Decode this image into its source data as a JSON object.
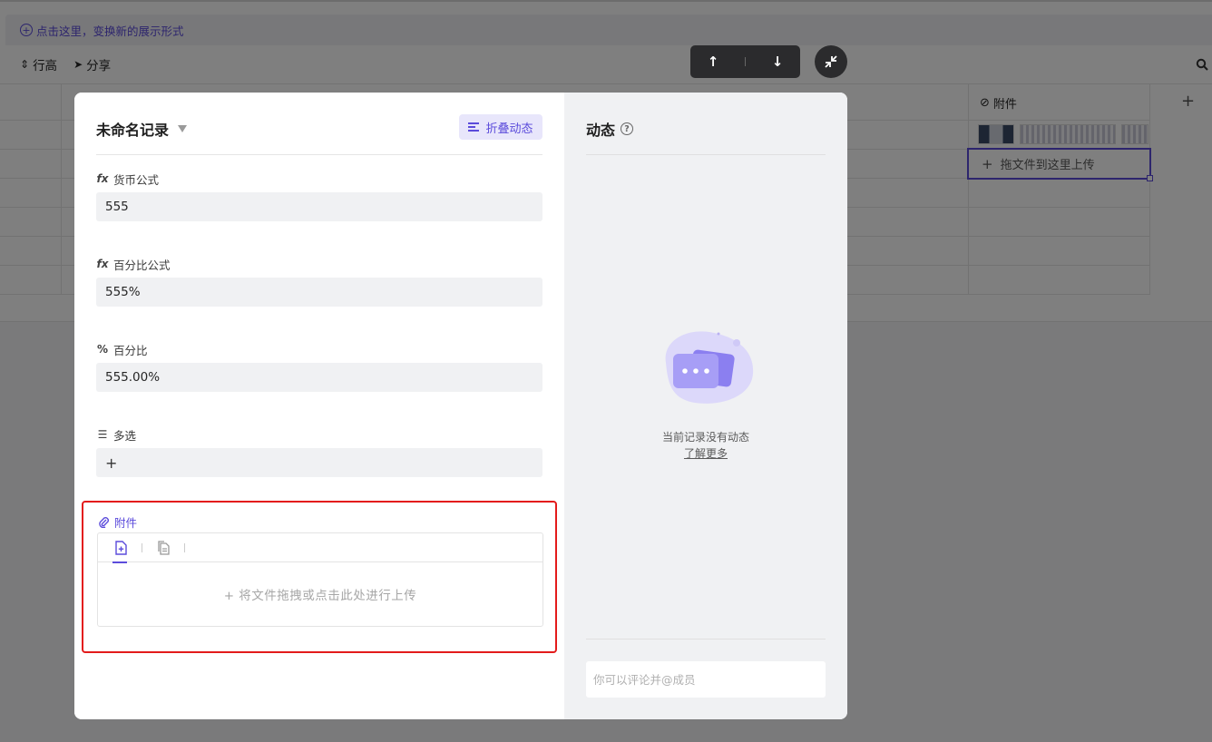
{
  "background": {
    "hint_text": "点击这里，变换新的展示形式",
    "toolbar": {
      "row_height_label": "行高",
      "share_label": "分享"
    },
    "grid": {
      "attachment_column_label": "附件",
      "upload_cell_text": "拖文件到这里上传"
    }
  },
  "nav": {
    "up_arrow": "↑",
    "down_arrow": "↓"
  },
  "record": {
    "title": "未命名记录",
    "fold_button_label": "折叠动态",
    "fields": [
      {
        "label": "货币公式",
        "icon": "fx-icon",
        "value": "555"
      },
      {
        "label": "百分比公式",
        "icon": "fx-icon",
        "value": "555%"
      },
      {
        "label": "百分比",
        "icon": "percent-icon",
        "value": "555.00%"
      },
      {
        "label": "多选",
        "icon": "multi-select-icon",
        "value": "+"
      }
    ],
    "attachment": {
      "label": "附件",
      "upload_hint": "+ 将文件拖拽或点击此处进行上传"
    }
  },
  "activity": {
    "title": "动态",
    "empty_text": "当前记录没有动态",
    "learn_more": "了解更多",
    "comment_placeholder": "你可以评论并@成员"
  },
  "colors": {
    "accent": "#5b4bdb",
    "highlight_border": "#e31b1b"
  }
}
